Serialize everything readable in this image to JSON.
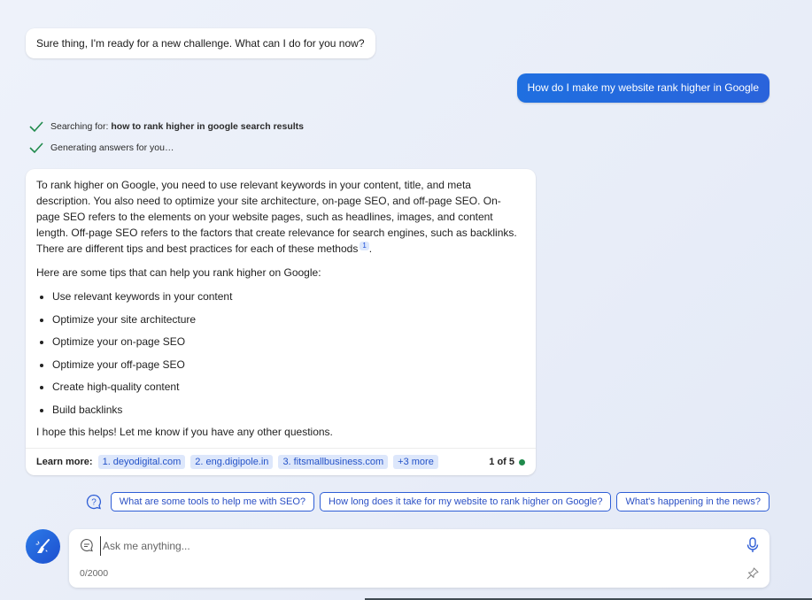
{
  "greeting": "Sure thing, I'm ready for a new challenge. What can I do for you now?",
  "user_message": "How do I make my website rank higher in Google",
  "status": {
    "searching_prefix": "Searching for: ",
    "searching_query": "how to rank higher in google search results",
    "generating": "Generating answers for you…"
  },
  "answer": {
    "para1": "To rank higher on Google, you need to use relevant keywords in your content, title, and meta description. You also need to optimize your site architecture, on-page SEO, and off-page SEO. On-page SEO refers to the elements on your website pages, such as headlines, images, and content length. Off-page SEO refers to the factors that create relevance for search engines, such as backlinks. There are different tips and best practices for each of these methods",
    "citation": "1",
    "para1_end": ".",
    "intro": "Here are some tips that can help you rank higher on Google:",
    "tips": [
      "Use relevant keywords in your content",
      "Optimize your site architecture",
      "Optimize your on-page SEO",
      "Optimize your off-page SEO",
      "Create high-quality content",
      "Build backlinks"
    ],
    "closing": "I hope this helps! Let me know if you have any other questions."
  },
  "learn_more": {
    "label": "Learn more:",
    "links": [
      "1. deyodigital.com",
      "2. eng.digipole.in",
      "3. fitsmallbusiness.com"
    ],
    "more": "+3 more",
    "count": "1 of 5"
  },
  "suggestions": [
    "What are some tools to help me with SEO?",
    "How long does it take for my website to rank higher on Google?",
    "What's happening in the news?"
  ],
  "compose": {
    "placeholder": "Ask me anything...",
    "value": "",
    "char_count": "0/2000"
  },
  "icons": {
    "check": "check-icon",
    "help": "question-icon",
    "new_topic": "broom-icon",
    "chat": "chat-bubble-icon",
    "mic": "microphone-icon",
    "pin": "pin-icon"
  },
  "colors": {
    "accent": "#2563eb",
    "check": "#1f8a4c",
    "chip_bg": "#dde7fb"
  }
}
